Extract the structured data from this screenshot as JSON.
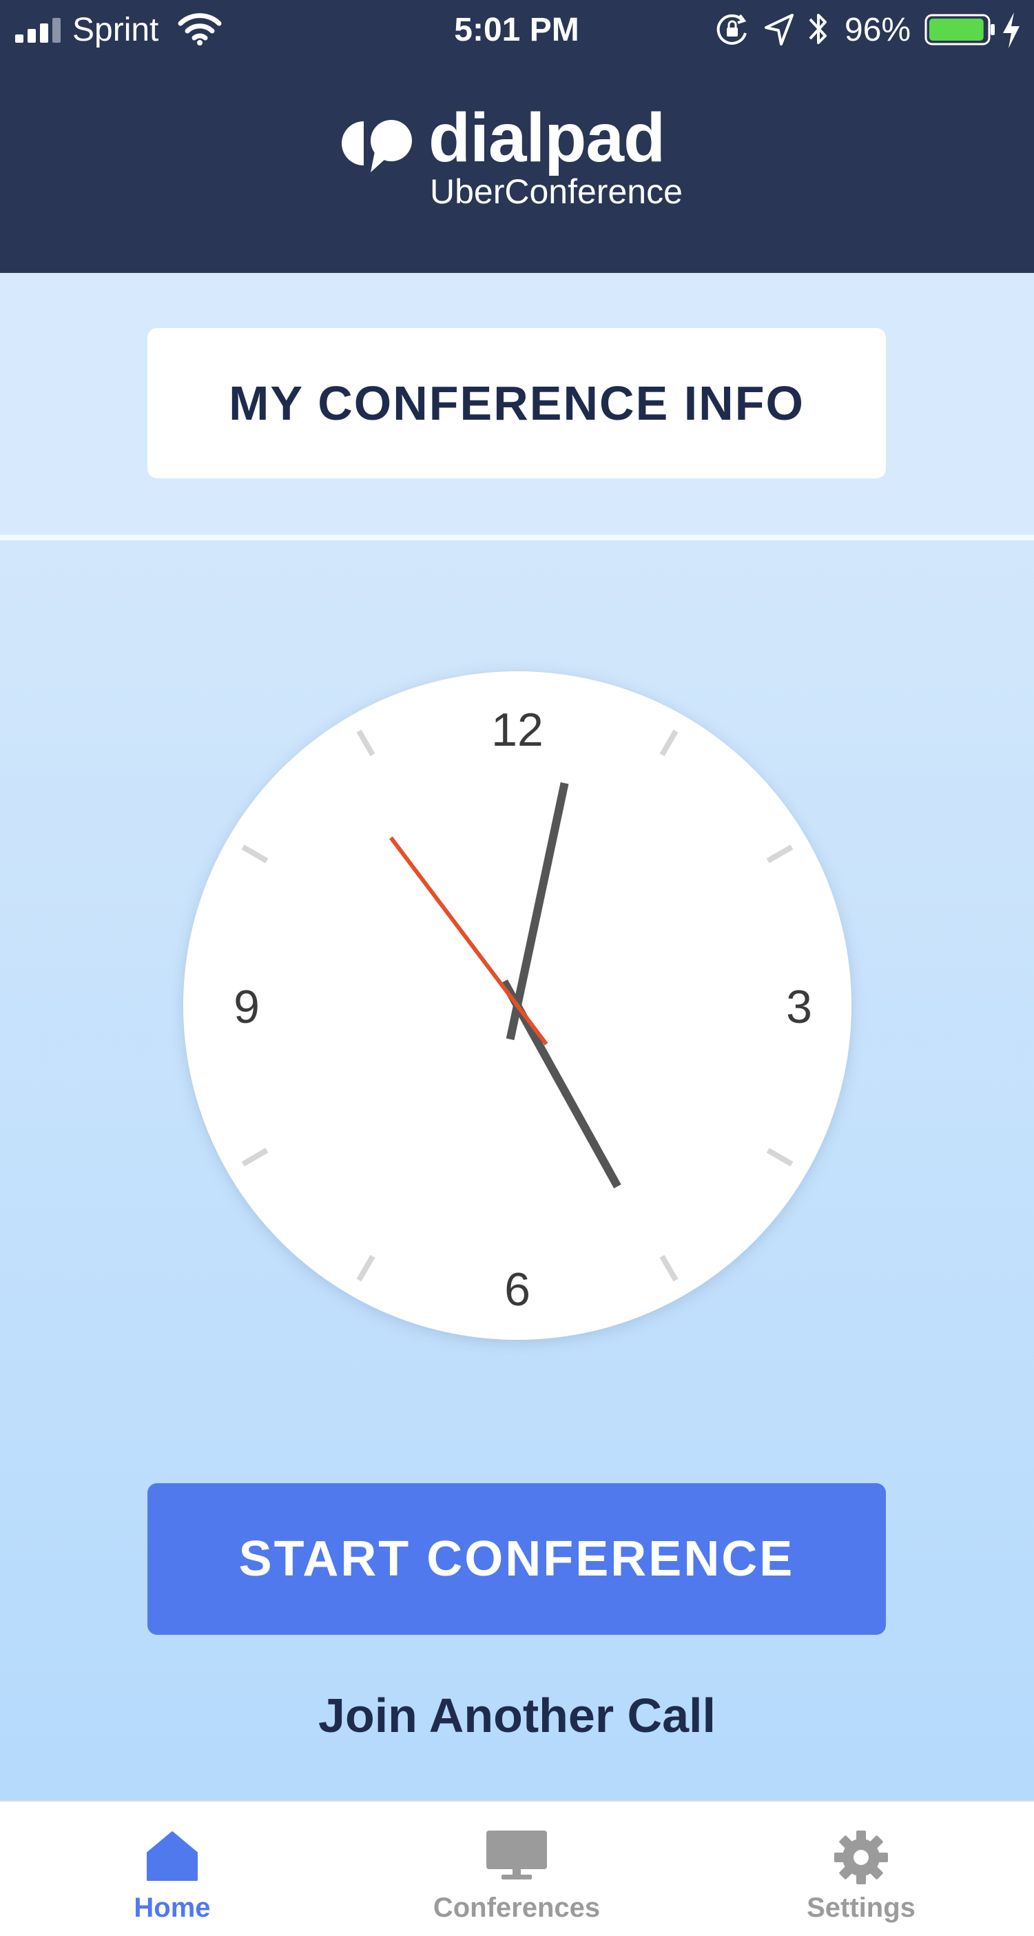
{
  "status_bar": {
    "carrier": "Sprint",
    "time": "5:01 PM",
    "battery_percent": "96%",
    "battery_level": 0.96,
    "icons": [
      "signal-icon",
      "wifi-icon",
      "rotation-lock-icon",
      "location-icon",
      "bluetooth-icon",
      "battery-icon",
      "charging-icon"
    ]
  },
  "header": {
    "brand": "dialpad",
    "product": "UberConference",
    "icon": "dialpad-logo-icon"
  },
  "info_button": {
    "label": "MY CONFERENCE INFO"
  },
  "clock": {
    "numerals": {
      "top": "12",
      "right": "3",
      "bottom": "6",
      "left": "9"
    },
    "hands": {
      "hour_deg": 151,
      "minute_deg": 12,
      "second_deg": 323
    },
    "colors": {
      "hands": "#555555",
      "second_hand": "#e4502a",
      "ticks": "#d6d6d6",
      "face": "#ffffff"
    }
  },
  "actions": {
    "start_label": "START CONFERENCE",
    "join_label": "Join Another Call"
  },
  "tab_bar": {
    "tabs": [
      {
        "label": "Home",
        "icon": "home-icon",
        "active": true
      },
      {
        "label": "Conferences",
        "icon": "monitor-icon",
        "active": false
      },
      {
        "label": "Settings",
        "icon": "gear-icon",
        "active": false
      }
    ]
  },
  "colors": {
    "header_bg": "#293655",
    "accent": "#5079ee",
    "text_dark": "#1f2b4d",
    "tab_inactive": "#9b9b9b",
    "battery_fill": "#5bd84c"
  }
}
